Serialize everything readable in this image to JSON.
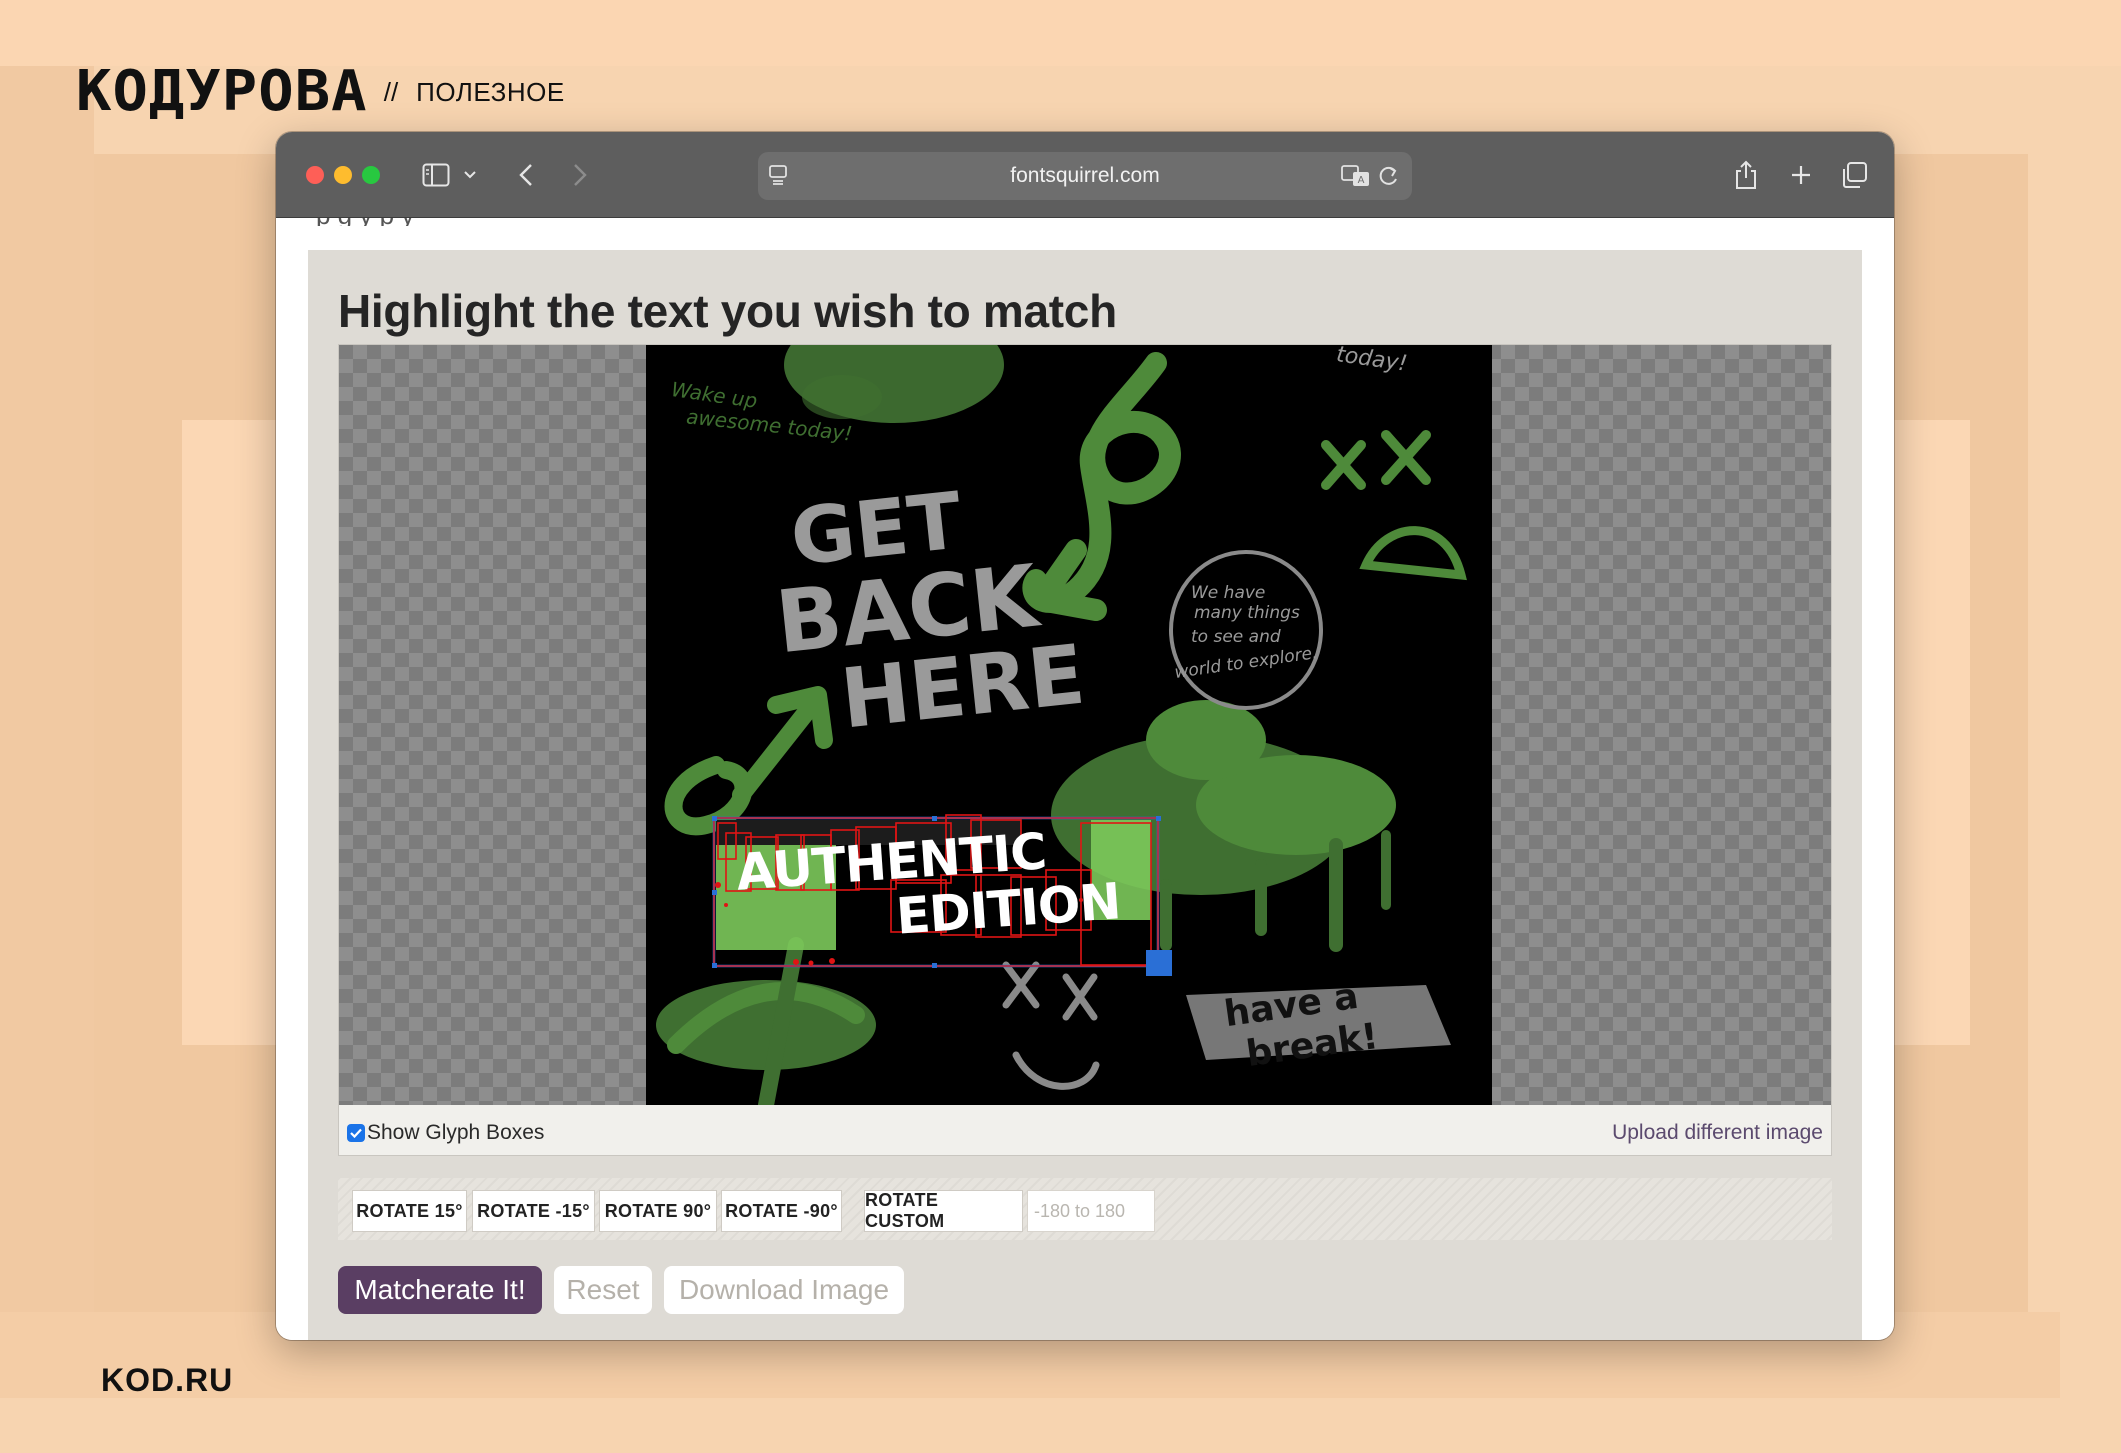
{
  "brand": {
    "logo": "KOДУРОВА",
    "separator": "//",
    "tagline": "ПОЛЕЗНОЕ",
    "footer": "KOD.RU"
  },
  "browser": {
    "url": "fontsquirrel.com",
    "icons": [
      "sidebar-icon",
      "chevron-down-icon",
      "back-icon",
      "forward-icon",
      "page-menu-icon",
      "translate-icon",
      "reload-icon",
      "share-icon",
      "new-tab-icon",
      "tabs-overview-icon"
    ]
  },
  "page": {
    "heading": "Highlight the text you wish to match",
    "show_glyph_boxes": {
      "label": "Show Glyph Boxes",
      "checked": true
    },
    "upload_link": "Upload different image",
    "rotate_buttons": [
      "ROTATE 15°",
      "ROTATE -15°",
      "ROTATE 90°",
      "ROTATE -90°",
      "ROTATE CUSTOM"
    ],
    "rotate_placeholder": "-180 to 180",
    "actions": {
      "matcherate": "Matcherate It!",
      "reset": "Reset",
      "download": "Download Image"
    }
  },
  "image": {
    "texts": {
      "get": "GET",
      "back": "BACK",
      "here": "HERE",
      "authentic": "AUTHENTIC",
      "edition": "EDITION",
      "wake_up": "Wake up",
      "awesome_today": "awesome today!",
      "today_top": "today!",
      "circle_line1": "We have",
      "circle_line2": "many things",
      "circle_line3": "to see and",
      "circle_line4": "world to explore.",
      "have_a": "have a",
      "break": "break!",
      "xx_top": "X X",
      "xx_bottom": "X X"
    },
    "colors": {
      "green": "#4e8a3a",
      "light_green": "#7cc95b",
      "gray_text": "#9a9a9a",
      "selection": "#2a6fd6",
      "glyph_box": "#e01414"
    }
  }
}
